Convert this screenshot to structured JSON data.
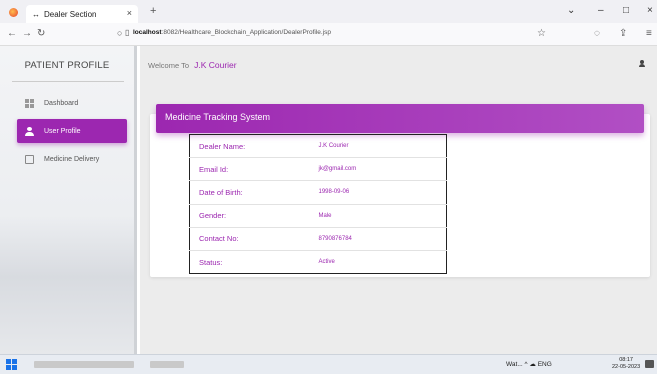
{
  "browser": {
    "tab_title": "Dealer Section",
    "tab_icon": "↔",
    "tab_close": "×",
    "new_tab": "+",
    "url_host": "localhost",
    "url_path": ":8082/Healthcare_Blockchain_Application/DealerProfile.jsp",
    "controls": {
      "dropdown": "⌄",
      "minimize": "–",
      "maximize": "□",
      "close": "×"
    }
  },
  "sidebar": {
    "title": "PATIENT PROFILE",
    "items": [
      {
        "label": "Dashboard",
        "icon": "dashboard-icon",
        "active": false
      },
      {
        "label": "User Profile",
        "icon": "user-icon",
        "active": true
      },
      {
        "label": "Medicine Delivery",
        "icon": "clipboard-icon",
        "active": false
      }
    ]
  },
  "header": {
    "welcome_label": "Welcome To",
    "user_name": "J.K Courier"
  },
  "card": {
    "title": "Medicine Tracking System",
    "rows": [
      {
        "label": "Dealer Name:",
        "value": "J.K Courier"
      },
      {
        "label": "Email Id:",
        "value": "jk@gmail.com"
      },
      {
        "label": "Date of Birth:",
        "value": "1998-09-06"
      },
      {
        "label": "Gender:",
        "value": "Male"
      },
      {
        "label": "Contact No:",
        "value": "8790876784"
      },
      {
        "label": "Status:",
        "value": "Active"
      }
    ]
  },
  "taskbar": {
    "tray": "Wat...  ^ ☁ ENG",
    "time": "08:17",
    "date": "22-05-2023"
  },
  "colors": {
    "accent": "#9c27b0",
    "background": "#ececec"
  }
}
